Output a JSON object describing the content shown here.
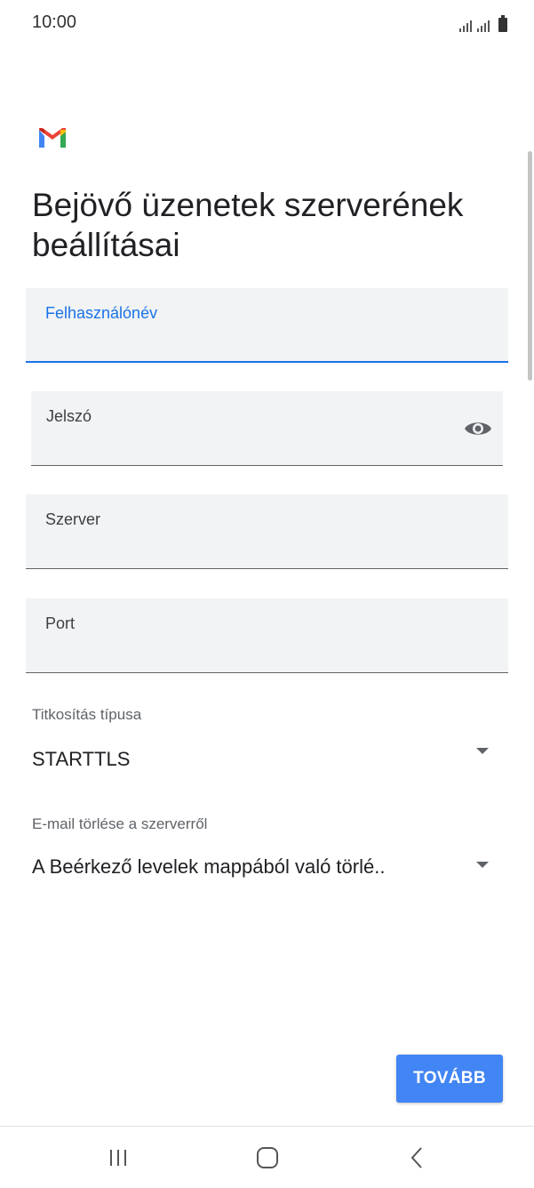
{
  "status_bar": {
    "time": "10:00",
    "icons": [
      "signal-icon",
      "signal-icon",
      "battery-icon"
    ]
  },
  "header": {
    "logo": "gmail-logo-icon",
    "title": "Bejövő üzenetek szerverének beállításai"
  },
  "form": {
    "username": {
      "label": "Felhasználónév",
      "value": "",
      "focused": true
    },
    "password": {
      "label": "Jelszó",
      "value": "",
      "icon": "eye-icon"
    },
    "server": {
      "label": "Szerver",
      "value": ""
    },
    "port": {
      "label": "Port",
      "value": ""
    },
    "encryption": {
      "label": "Titkosítás típusa",
      "selected": "STARTTLS"
    },
    "delete_from_server": {
      "label": "E-mail törlése a szerverről",
      "selected": "A Beérkező levelek mappából való törlé.."
    }
  },
  "actions": {
    "next_label": "TOVÁBB"
  },
  "nav_bar": {
    "icons": [
      "recent-apps-icon",
      "home-icon",
      "back-icon"
    ]
  },
  "colors": {
    "accent": "#1a73e8",
    "button": "#4285f4",
    "field_bg": "#f1f3f4"
  }
}
